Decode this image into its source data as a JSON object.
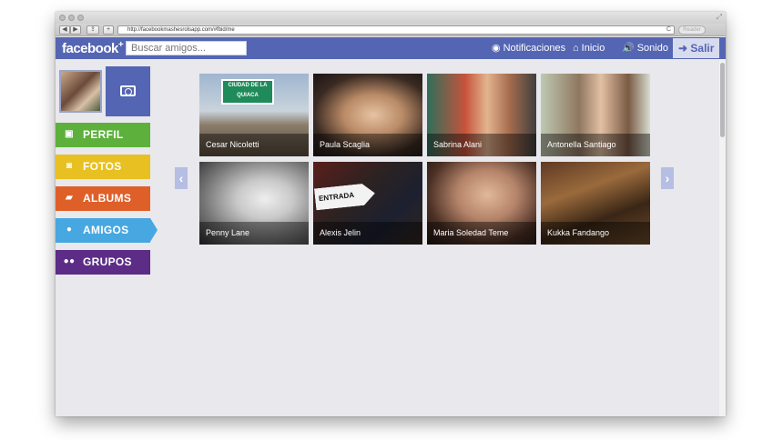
{
  "browser": {
    "url": "http://facebookmashesrolsapp.com/#fbid/me",
    "reader_label": "Reader",
    "back_glyph": "◀",
    "forward_glyph": "▶",
    "share_glyph": "⇪",
    "add_glyph": "+",
    "reload_glyph": "C",
    "apple_glyph": "",
    "resize_glyph": "⤢"
  },
  "header": {
    "logo": "facebook",
    "logo_plus": "+",
    "search_placeholder": "Buscar amigos...",
    "nav": [
      {
        "label": "Notificaciones",
        "icon": "globe-icon",
        "glyph": "◉"
      },
      {
        "label": "Inicio",
        "icon": "home-icon",
        "glyph": "⌂"
      },
      {
        "label": "Sonido",
        "icon": "speaker-icon",
        "glyph": "🔊"
      }
    ],
    "logout_label": "Salir",
    "logout_glyph": "➜"
  },
  "sidebar": {
    "menu": [
      {
        "label": "PERFIL",
        "icon": "profile-card-icon",
        "glyph": "▣",
        "color": "#5cb03b"
      },
      {
        "label": "FOTOS",
        "icon": "camera-icon",
        "glyph": "◙",
        "color": "#e8c021"
      },
      {
        "label": "ALBUMS",
        "icon": "folder-icon",
        "glyph": "▰",
        "color": "#df5f29"
      },
      {
        "label": "AMIGOS",
        "icon": "person-icon",
        "glyph": "●",
        "color": "#46a7e1",
        "active": true
      },
      {
        "label": "GRUPOS",
        "icon": "group-icon",
        "glyph": "●●",
        "color": "#5c2c86"
      }
    ]
  },
  "friends": [
    {
      "name": "Cesar Nicoletti",
      "sign": "CIUDAD DE LA QUIACA"
    },
    {
      "name": "Paula Scaglia"
    },
    {
      "name": "Sabrina Alani"
    },
    {
      "name": "Antonella Santiago"
    },
    {
      "name": "Penny Lane"
    },
    {
      "name": "Alexis Jelin",
      "sign": "ENTRADA"
    },
    {
      "name": "Maria Soledad Teme"
    },
    {
      "name": "Kukka Fandango"
    }
  ],
  "pager": {
    "prev_glyph": "‹",
    "next_glyph": "›"
  },
  "colors": {
    "brand": "#5465b3",
    "background": "#e8e8ed"
  }
}
